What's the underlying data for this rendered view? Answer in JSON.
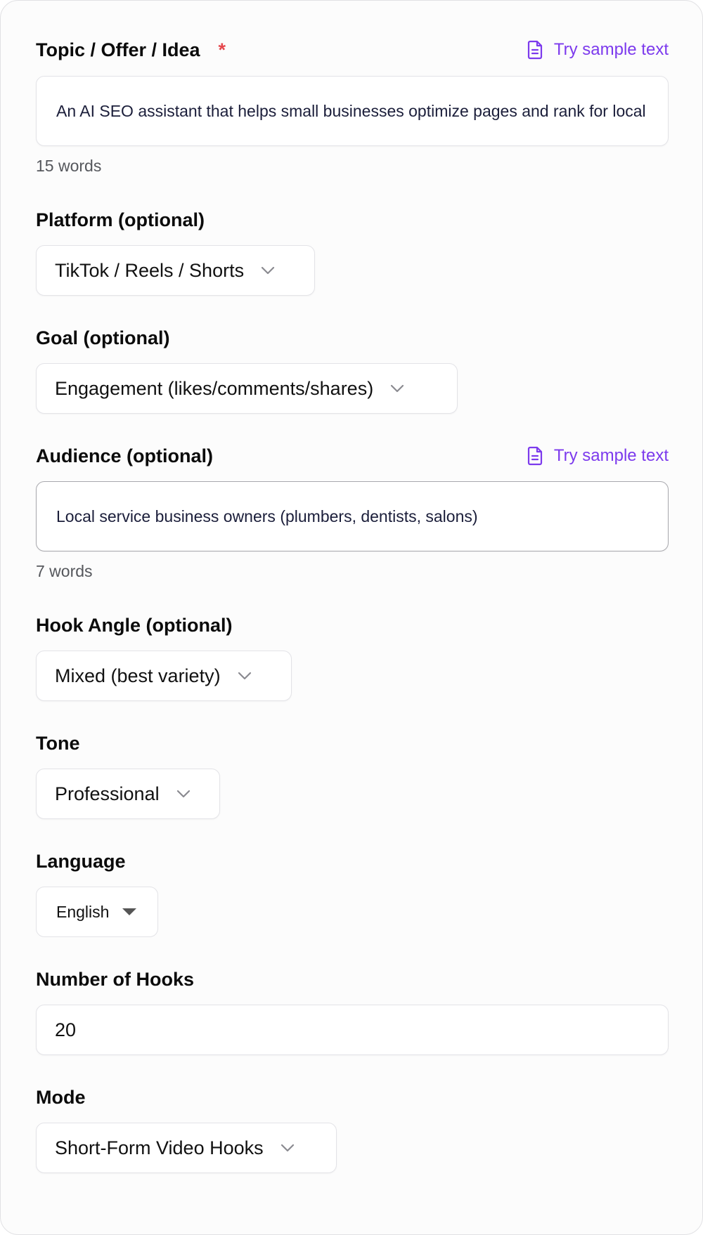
{
  "topic": {
    "label": "Topic / Offer / Idea",
    "required_mark": "*",
    "sample_link": "Try sample text",
    "value": "An AI SEO assistant that helps small businesses optimize pages and rank for local searches",
    "word_count": "15 words"
  },
  "platform": {
    "label": "Platform (optional)",
    "value": "TikTok / Reels / Shorts"
  },
  "goal": {
    "label": "Goal (optional)",
    "value": "Engagement (likes/comments/shares)"
  },
  "audience": {
    "label": "Audience (optional)",
    "sample_link": "Try sample text",
    "value": "Local service business owners (plumbers, dentists, salons)",
    "word_count": "7 words"
  },
  "hook_angle": {
    "label": "Hook Angle (optional)",
    "value": "Mixed (best variety)"
  },
  "tone": {
    "label": "Tone",
    "value": "Professional"
  },
  "language": {
    "label": "Language",
    "value": "English"
  },
  "number_of_hooks": {
    "label": "Number of Hooks",
    "value": "20"
  },
  "mode": {
    "label": "Mode",
    "value": "Short-Form Video Hooks"
  },
  "colors": {
    "accent": "#7c3aed",
    "required": "#e5484d",
    "text": "#111111",
    "muted": "#55575c",
    "border": "#e3e3e7"
  },
  "icons": {
    "sample": "document-icon",
    "dropdown": "chevron-down-icon",
    "native_dropdown": "caret-down-icon"
  }
}
